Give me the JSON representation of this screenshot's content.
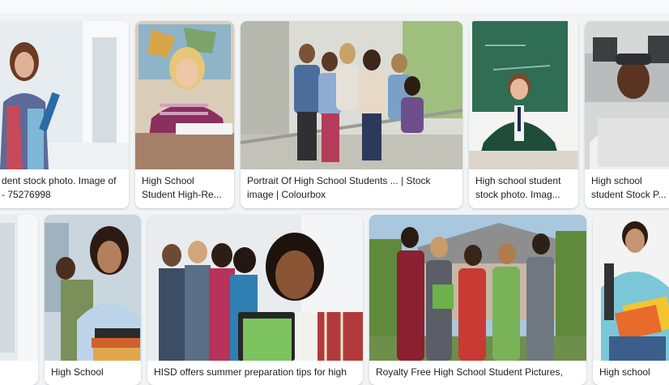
{
  "results_row1": [
    {
      "caption_line1": "dent stock photo. Image of",
      "caption_line2": "- 75276998"
    },
    {
      "caption_line1": "High School",
      "caption_line2": "Student High-Re..."
    },
    {
      "caption_line1": "Portrait Of High School Students ... | Stock",
      "caption_line2": "image | Colourbox"
    },
    {
      "caption_line1": "High school student",
      "caption_line2": "stock photo. Imag..."
    },
    {
      "caption_line1": "High school",
      "caption_line2": "student Stock P..."
    }
  ],
  "results_row2": [
    {
      "caption_line1": "High School"
    },
    {
      "caption_line1": "HISD offers summer preparation tips for high"
    },
    {
      "caption_line1": "Royalty Free High School Student Pictures,"
    },
    {
      "caption_line1": "High school"
    }
  ],
  "colors": {
    "page_background": "#f1f3f4",
    "card_background": "#ffffff",
    "caption_text": "#202124"
  },
  "icons": [
    "image-thumbnail"
  ]
}
